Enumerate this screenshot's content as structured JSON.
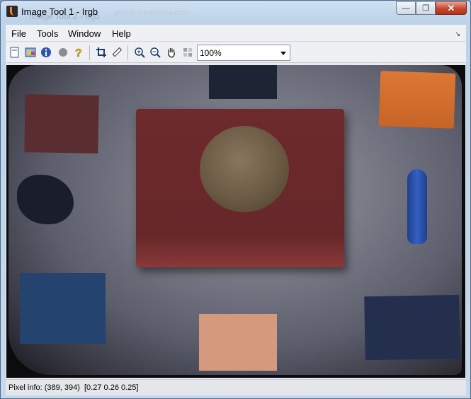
{
  "window": {
    "title": "Image Tool 1 - Irgb",
    "background_title": "Image Tool 2 - Irgb",
    "background_url": "...github.mediavida.com..."
  },
  "menubar": {
    "items": [
      "File",
      "Tools",
      "Window",
      "Help"
    ]
  },
  "toolbar": {
    "icons": [
      "new-figure-icon",
      "image-info-icon",
      "info-icon",
      "record-icon",
      "help-icon",
      "crop-icon",
      "measure-icon",
      "zoom-in-icon",
      "zoom-out-icon",
      "pan-icon",
      "pixel-region-icon"
    ],
    "zoom": {
      "selected": "100%"
    }
  },
  "status": {
    "pixel_info": "Pixel info: (389, 394)  [0.27 0.26 0.25]"
  },
  "colors": {
    "title_gradient": "#c6d8ec",
    "close_red": "#c7442c",
    "tan_box": "#7d2f2f",
    "orange_square": "#d9702f",
    "blue_square": "#25406f",
    "peach_square": "#d49a7d"
  }
}
